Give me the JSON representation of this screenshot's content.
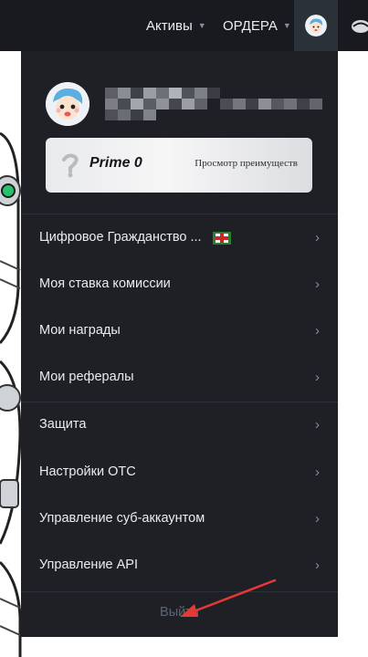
{
  "nav": {
    "assets_label": "Активы",
    "orders_label": "ОРДЕРА"
  },
  "prime": {
    "title": "Prime 0",
    "link": "Просмотр преимуществ"
  },
  "menu": {
    "items": [
      {
        "label": "Цифровое Гражданство ..."
      },
      {
        "label": "Моя ставка комиссии"
      },
      {
        "label": "Мои награды"
      },
      {
        "label": "Мои рефералы"
      },
      {
        "label": "Защита"
      },
      {
        "label": "Настройки OTC"
      },
      {
        "label": "Управление суб-аккаунтом"
      },
      {
        "label": "Управление API"
      }
    ],
    "chevron": "›",
    "logout": "Выйти"
  },
  "colors": {
    "topbar": "#181a20",
    "panel": "#1e2026",
    "accent_red": "#e53935"
  },
  "icons": {
    "nav_caret": "caret-down-icon",
    "chevron": "chevron-right-icon",
    "flag": "flag-icon",
    "globe": "globe-icon",
    "prime": "prime-badge-icon"
  }
}
